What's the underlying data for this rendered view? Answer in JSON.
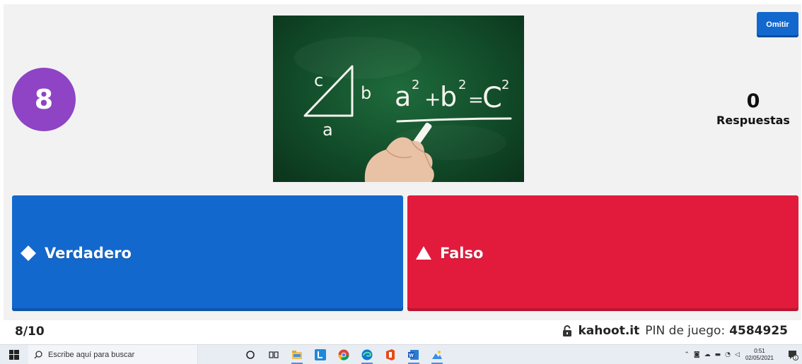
{
  "game": {
    "timer": "8",
    "skip_label": "Omitir",
    "answers_count": "0",
    "answers_label": "Respuestas",
    "image_alt": "Pitágoras en pizarra",
    "image_text": {
      "side_a": "c",
      "side_b": "b",
      "side_c": "a",
      "formula_a": "a",
      "formula_exp1": "2",
      "formula_plus": "+",
      "formula_b": "b",
      "formula_exp2": "2",
      "formula_eq": "=",
      "formula_c": "C",
      "formula_exp3": "2"
    },
    "answers": [
      {
        "label": "Verdadero",
        "shape": "diamond-icon",
        "color": "#1368ce"
      },
      {
        "label": "Falso",
        "shape": "triangle-icon",
        "color": "#e21b3c"
      }
    ],
    "timer_color": "#8e44c4"
  },
  "footer": {
    "progress": "8/10",
    "site": "kahoot.it",
    "pin_label": "PIN de juego:",
    "pin": "4584925"
  },
  "taskbar": {
    "search_placeholder": "Escribe aquí para buscar",
    "apps": [
      "cortana-icon",
      "task-view-icon",
      "file-explorer-icon",
      "l-app-icon",
      "chrome-icon",
      "edge-icon",
      "office-icon",
      "word-icon",
      "photos-icon"
    ],
    "time": "0:51",
    "date": "02/05/2021",
    "notification_count": "1"
  }
}
